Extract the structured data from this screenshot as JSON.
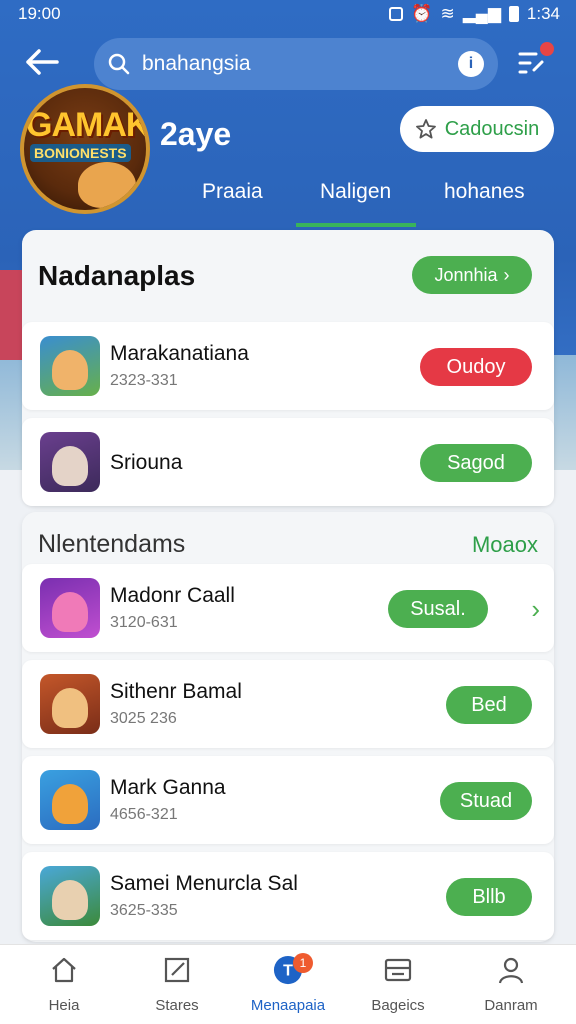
{
  "status_bar": {
    "time": "19:00",
    "clock_right": "1:34"
  },
  "search": {
    "value": "bnahangsia"
  },
  "app": {
    "name": "2aye",
    "logo_text_1": "GAMAK",
    "logo_text_2": "BONIONESTS",
    "follow_label": "Cadoucsin"
  },
  "tabs": [
    {
      "label": "Praaia"
    },
    {
      "label": "Naligen"
    },
    {
      "label": "hohanes"
    }
  ],
  "section1": {
    "title": "Nadanaplas",
    "see_all_label": "Jonnhia",
    "items": [
      {
        "title": "Marakanatiana",
        "subtitle": "2323-331",
        "action": "Oudoy",
        "action_color": "#e53945"
      },
      {
        "title": "Sriouna",
        "subtitle": "",
        "action": "Sagod",
        "action_color": "#4caf50"
      }
    ]
  },
  "section2": {
    "title": "Nlentendams",
    "more_label": "Moaox",
    "items": [
      {
        "title": "Madonr Caall",
        "subtitle": "3120-631",
        "action": "Susal."
      },
      {
        "title": "Sithenr Bamal",
        "subtitle": "3025 236",
        "action": "Bed"
      },
      {
        "title": "Mark Ganna",
        "subtitle": "4656-321",
        "action": "Stuad"
      },
      {
        "title": "Samei Menurcla Sal",
        "subtitle": "3625-335",
        "action": "Bllb"
      }
    ]
  },
  "bottom_nav": [
    {
      "label": "Heia",
      "icon": "home-icon"
    },
    {
      "label": "Stares",
      "icon": "edit-icon"
    },
    {
      "label": "Menaapaia",
      "icon": "notification-icon",
      "badge": "1",
      "active": true
    },
    {
      "label": "Bageics",
      "icon": "inbox-icon"
    },
    {
      "label": "Danram",
      "icon": "profile-icon"
    }
  ],
  "colors": {
    "primary": "#2b63b8",
    "accent_green": "#4caf50",
    "accent_red": "#e53945",
    "active_nav": "#1e63c6"
  }
}
